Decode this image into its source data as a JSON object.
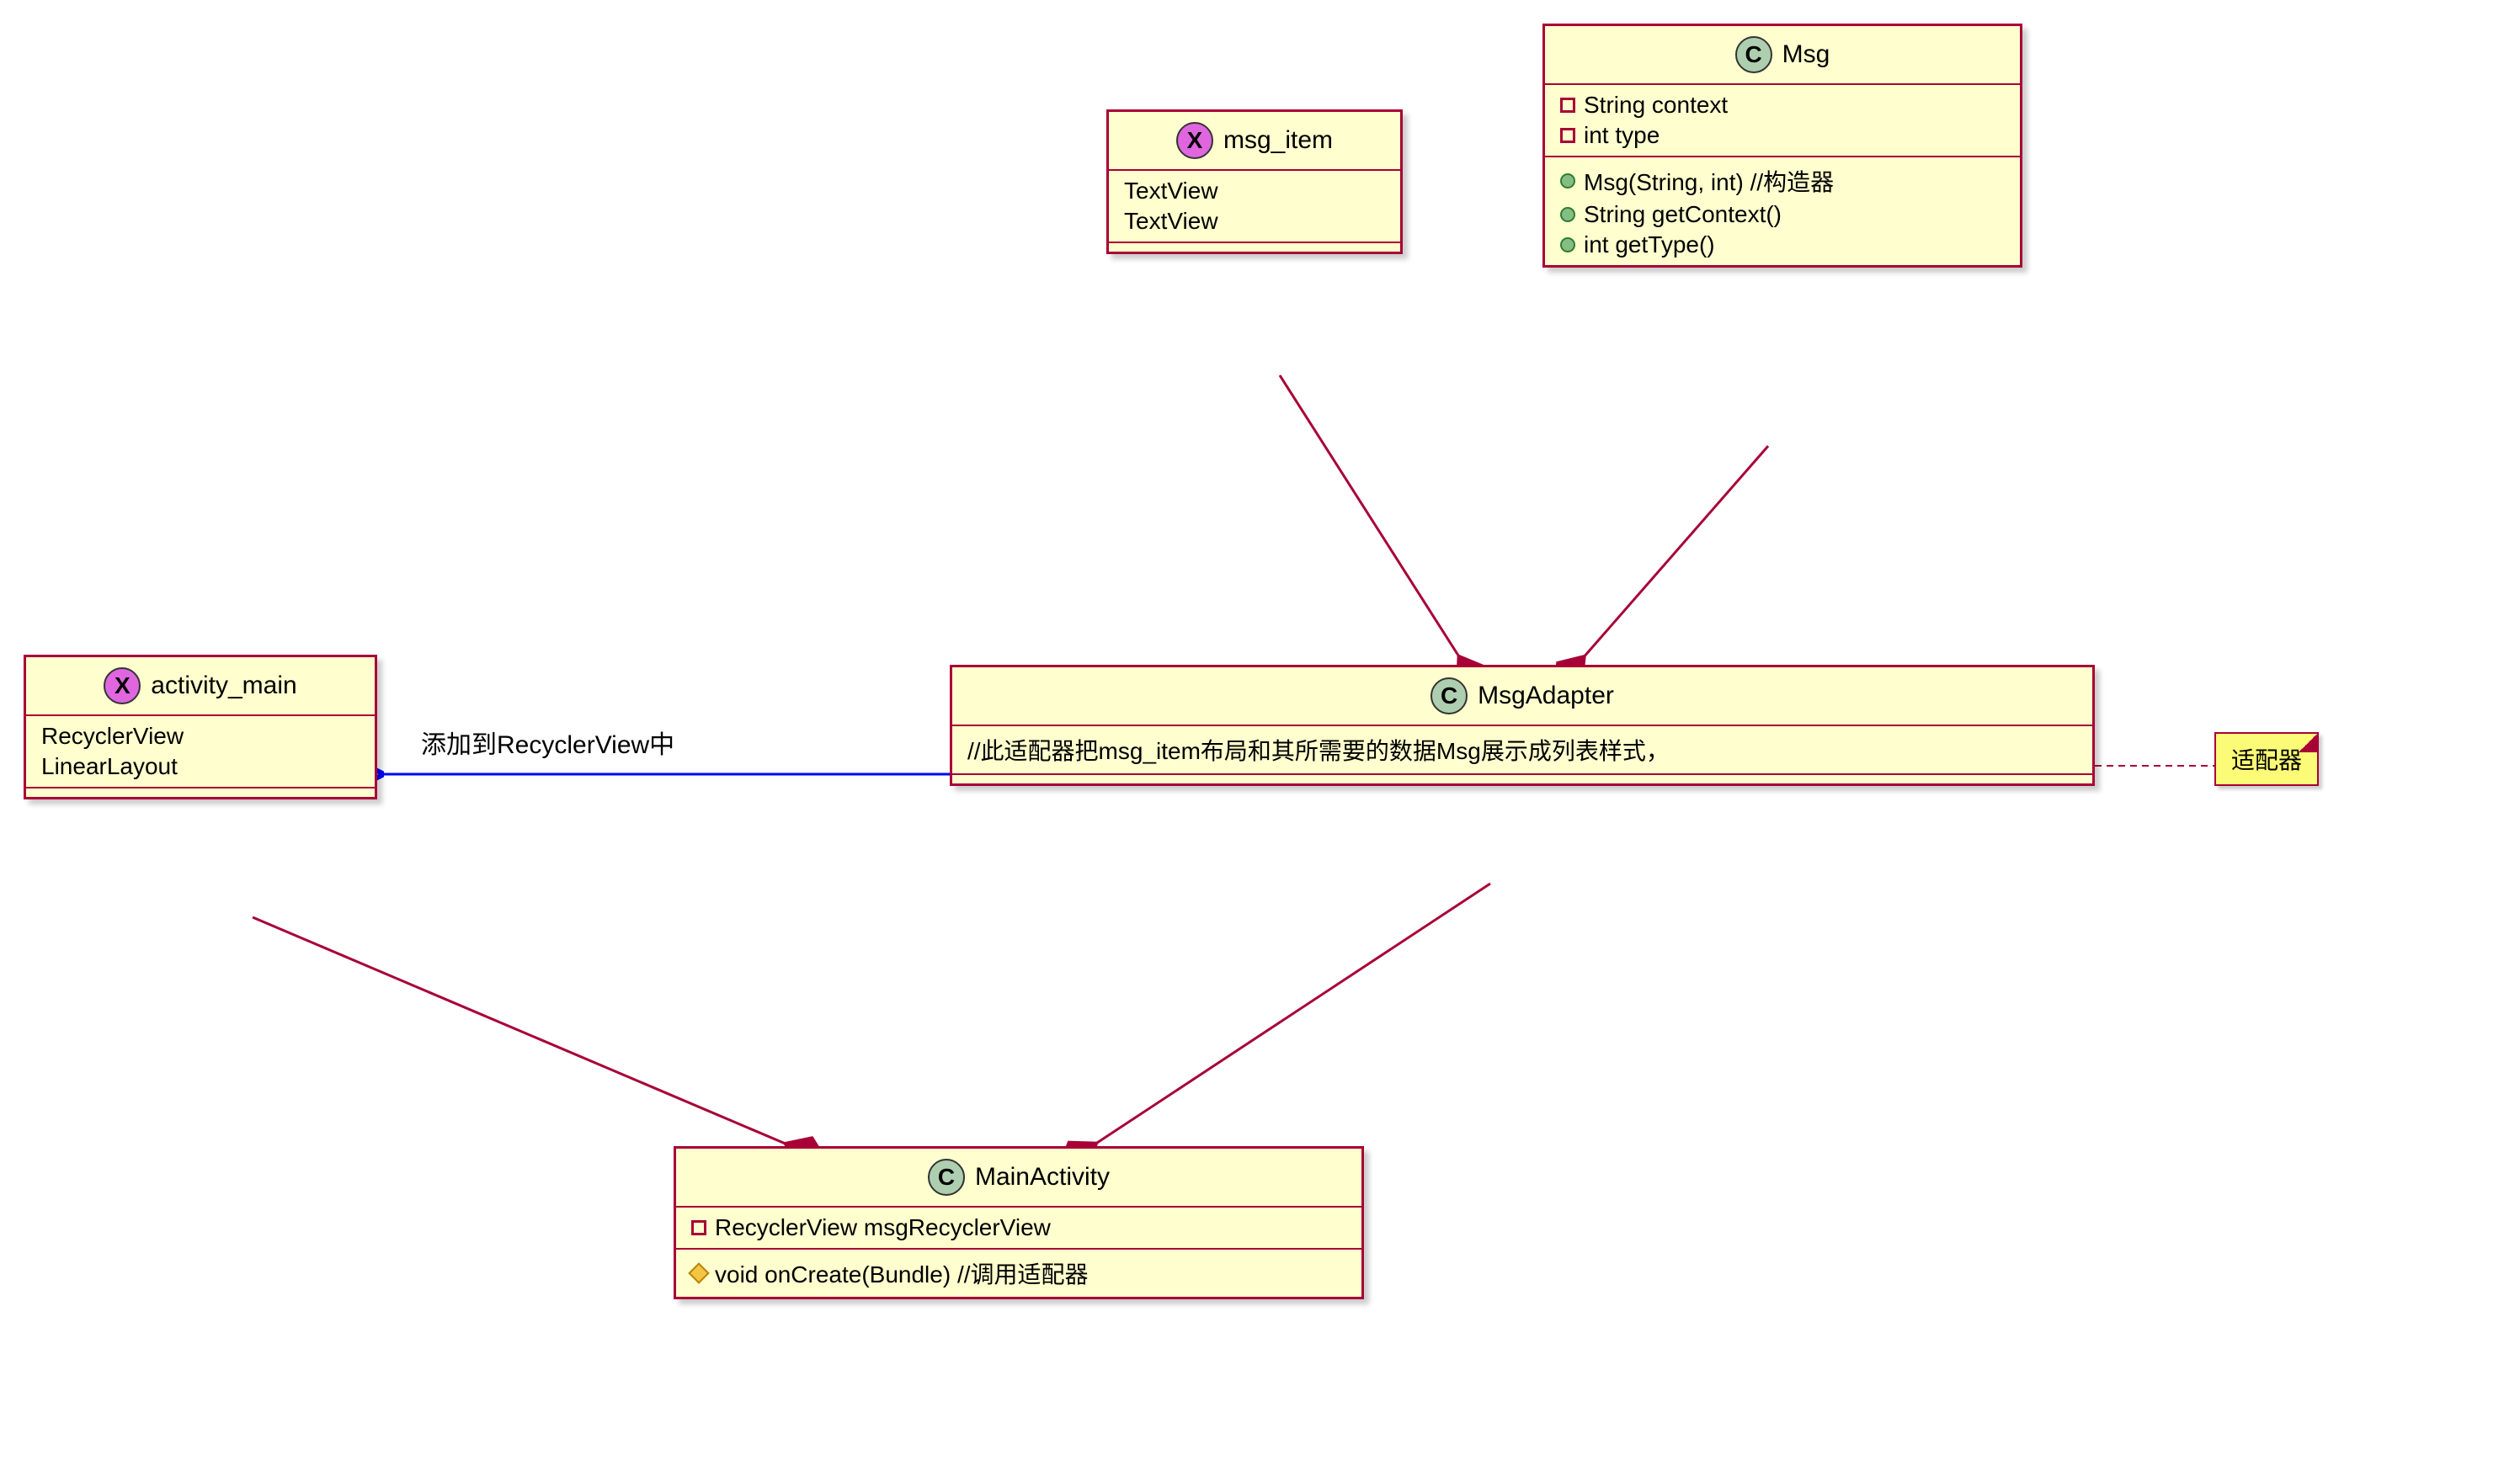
{
  "chart_data": {
    "type": "uml_class_diagram",
    "classes": [
      {
        "id": "msg_item",
        "stereotype": "X",
        "name": "msg_item",
        "attributes": [
          "TextView",
          "TextView"
        ],
        "methods": []
      },
      {
        "id": "Msg",
        "stereotype": "C",
        "name": "Msg",
        "attributes": [
          {
            "visibility": "private",
            "text": "String context"
          },
          {
            "visibility": "private",
            "text": "int type"
          }
        ],
        "methods": [
          {
            "visibility": "public",
            "text": "Msg(String, int) //构造器"
          },
          {
            "visibility": "public",
            "text": "String getContext()"
          },
          {
            "visibility": "public",
            "text": "int getType()"
          }
        ]
      },
      {
        "id": "activity_main",
        "stereotype": "X",
        "name": "activity_main",
        "attributes": [
          "RecyclerView",
          "LinearLayout"
        ],
        "methods": []
      },
      {
        "id": "MsgAdapter",
        "stereotype": "C",
        "name": "MsgAdapter",
        "attributes": [],
        "methods": [],
        "body_text": "//此适配器把msg_item布局和其所需要的数据Msg展示成列表样式，",
        "note": "适配器"
      },
      {
        "id": "MainActivity",
        "stereotype": "C",
        "name": "MainActivity",
        "attributes": [
          {
            "visibility": "private",
            "text": "RecyclerView msgRecyclerView"
          }
        ],
        "methods": [
          {
            "visibility": "protected",
            "text": "void onCreate(Bundle) //调用适配器"
          }
        ]
      }
    ],
    "relationships": [
      {
        "from": "MsgAdapter",
        "to": "msg_item",
        "type": "composition"
      },
      {
        "from": "MsgAdapter",
        "to": "Msg",
        "type": "composition"
      },
      {
        "from": "MsgAdapter",
        "to": "activity_main",
        "type": "dependency",
        "label": "添加到RecyclerView中",
        "color": "blue"
      },
      {
        "from": "MainActivity",
        "to": "activity_main",
        "type": "composition"
      },
      {
        "from": "MainActivity",
        "to": "MsgAdapter",
        "type": "composition"
      },
      {
        "from": "MsgAdapter",
        "to": "note_adapter",
        "type": "note_link"
      }
    ]
  },
  "msg_item": {
    "name": "msg_item",
    "attr1": "TextView",
    "attr2": "TextView"
  },
  "Msg": {
    "name": "Msg",
    "attr1": "String context",
    "attr2": "int type",
    "m1": "Msg(String, int) //构造器",
    "m2": "String getContext()",
    "m3": "int getType()"
  },
  "activity_main": {
    "name": "activity_main",
    "attr1": "RecyclerView",
    "attr2": "LinearLayout"
  },
  "MsgAdapter": {
    "name": "MsgAdapter",
    "body": "//此适配器把msg_item布局和其所需要的数据Msg展示成列表样式，",
    "note": "适配器"
  },
  "MainActivity": {
    "name": "MainActivity",
    "attr1": "RecyclerView msgRecyclerView",
    "m1": "void onCreate(Bundle) //调用适配器"
  },
  "edge_label": "添加到RecyclerView中"
}
